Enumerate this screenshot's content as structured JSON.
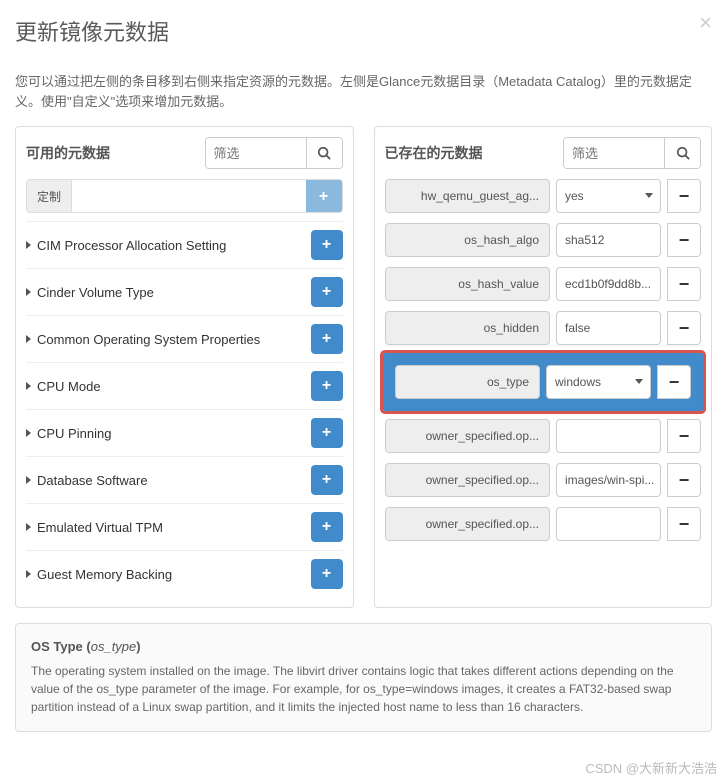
{
  "modal": {
    "title": "更新镜像元数据",
    "description": "您可以通过把左侧的条目移到右侧来指定资源的元数据。左侧是Glance元数据目录（Metadata Catalog）里的元数据定义。使用\"自定义\"选项来增加元数据。"
  },
  "left": {
    "title": "可用的元数据",
    "filter_placeholder": "筛选",
    "custom_label": "定制",
    "items": [
      "CIM Processor Allocation Setting",
      "Cinder Volume Type",
      "Common Operating System Properties",
      "CPU Mode",
      "CPU Pinning",
      "Database Software",
      "Emulated Virtual TPM",
      "Guest Memory Backing"
    ]
  },
  "right": {
    "title": "已存在的元数据",
    "filter_placeholder": "筛选",
    "rows": [
      {
        "label": "hw_qemu_guest_ag...",
        "value": "yes",
        "type": "select"
      },
      {
        "label": "os_hash_algo",
        "value": "sha512",
        "type": "text"
      },
      {
        "label": "os_hash_value",
        "value": "ecd1b0f9dd8b...",
        "type": "text"
      },
      {
        "label": "os_hidden",
        "value": "false",
        "type": "text"
      },
      {
        "label": "os_type",
        "value": "windows",
        "type": "select",
        "highlighted": true
      },
      {
        "label": "owner_specified.op...",
        "value": "",
        "type": "text"
      },
      {
        "label": "owner_specified.op...",
        "value": "images/win-spi...",
        "type": "text"
      },
      {
        "label": "owner_specified.op...",
        "value": "",
        "type": "text"
      }
    ]
  },
  "info": {
    "title_label": "OS Type",
    "title_key": "os_type",
    "text": "The operating system installed on the image. The libvirt driver contains logic that takes different actions depending on the value of the os_type parameter of the image. For example, for os_type=windows images, it creates a FAT32-based swap partition instead of a Linux swap partition, and it limits the injected host name to less than 16 characters."
  },
  "watermark": "CSDN @大新新大浩浩"
}
